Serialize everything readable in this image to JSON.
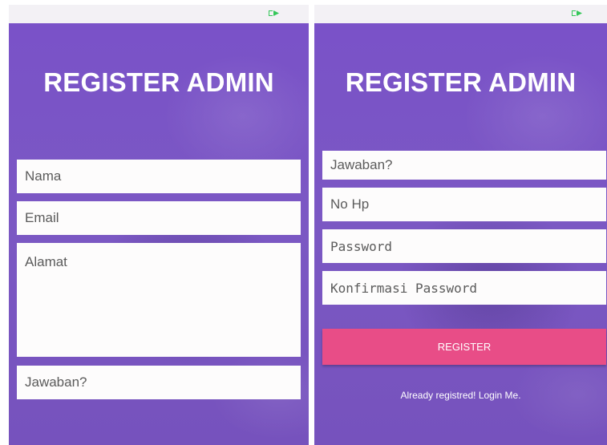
{
  "screens": {
    "left": {
      "title": "REGISTER ADMIN",
      "fields": {
        "nama": "Nama",
        "email": "Email",
        "alamat": "Alamat",
        "jawaban": "Jawaban?"
      }
    },
    "right": {
      "title": "REGISTER ADMIN",
      "fields": {
        "jawaban": "Jawaban?",
        "no_hp": "No Hp",
        "password": "Password",
        "konfirmasi_password": "Konfirmasi Password"
      },
      "register_label": "REGISTER",
      "login_link": "Already registred! Login Me."
    }
  },
  "icons": {
    "status": "battery-icon"
  },
  "colors": {
    "background": "#7a55c4",
    "button": "#e84d87",
    "field": "#fdfcfc",
    "text_light": "#ffffff"
  }
}
